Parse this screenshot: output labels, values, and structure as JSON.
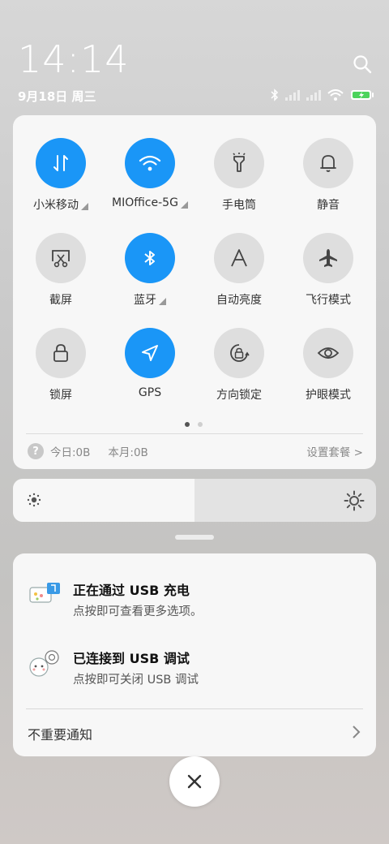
{
  "status": {
    "time": "14:14",
    "date": "9月18日 周三",
    "icons": [
      "bluetooth-icon",
      "signal-icon",
      "signal-icon",
      "wifi-icon",
      "battery-charging-icon"
    ]
  },
  "quick_settings": {
    "tiles": [
      {
        "label": "小米移动",
        "state": "on",
        "icon": "mobile-data-icon",
        "has_dropdown": true
      },
      {
        "label": "MIOffice-5G",
        "state": "on",
        "icon": "wifi-icon",
        "has_dropdown": true
      },
      {
        "label": "手电筒",
        "state": "off",
        "icon": "flashlight-icon",
        "has_dropdown": false
      },
      {
        "label": "静音",
        "state": "off",
        "icon": "bell-icon",
        "has_dropdown": false
      },
      {
        "label": "截屏",
        "state": "off",
        "icon": "screenshot-icon",
        "has_dropdown": false
      },
      {
        "label": "蓝牙",
        "state": "on",
        "icon": "bluetooth-icon",
        "has_dropdown": true
      },
      {
        "label": "自动亮度",
        "state": "off",
        "icon": "auto-brightness-icon",
        "has_dropdown": false
      },
      {
        "label": "飞行模式",
        "state": "off",
        "icon": "airplane-icon",
        "has_dropdown": false
      },
      {
        "label": "锁屏",
        "state": "off",
        "icon": "lock-icon",
        "has_dropdown": false
      },
      {
        "label": "GPS",
        "state": "on",
        "icon": "gps-icon",
        "has_dropdown": false
      },
      {
        "label": "方向锁定",
        "state": "off",
        "icon": "rotation-lock-icon",
        "has_dropdown": false
      },
      {
        "label": "护眼模式",
        "state": "off",
        "icon": "eye-icon",
        "has_dropdown": false
      }
    ],
    "page_count": 2,
    "active_page": 1,
    "usage": {
      "help": "?",
      "today": "今日:0B",
      "month": "本月:0B",
      "plan_link": "设置套餐 >"
    }
  },
  "brightness": {
    "level": 0.5
  },
  "notifications": [
    {
      "title": "正在通过 USB 充电",
      "text": "点按即可查看更多选项。",
      "icon": "usb-charging-icon"
    },
    {
      "title": "已连接到 USB 调试",
      "text": "点按即可关闭 USB 调试",
      "icon": "usb-debug-icon"
    }
  ],
  "unimportant": {
    "label": "不重要通知",
    "chevron": "›"
  },
  "colors": {
    "accent": "#1a96f7",
    "tile_off": "#dedede",
    "panel": "#f7f7f7"
  }
}
